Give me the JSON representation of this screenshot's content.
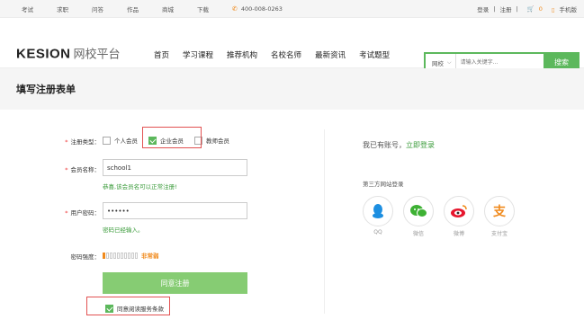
{
  "topbar": {
    "nav": [
      "考试",
      "求职",
      "问答",
      "作品",
      "商城",
      "下载"
    ],
    "phone": "400-008-0263",
    "login": "登录",
    "register": "注册",
    "cart_count": "0",
    "mobile": "手机版"
  },
  "header": {
    "logo_main": "KESION",
    "logo_sub": "网校平台",
    "nav": [
      "首页",
      "学习课程",
      "推荐机构",
      "名校名师",
      "最新资讯",
      "考试题型"
    ],
    "search": {
      "scope": "网校",
      "placeholder": "请输入关键字...",
      "button": "搜索"
    }
  },
  "page_title": "填写注册表单",
  "form": {
    "type_label": "注册类型：",
    "types": [
      {
        "label": "个人会员",
        "checked": false
      },
      {
        "label": "企业会员",
        "checked": true
      },
      {
        "label": "教师会员",
        "checked": false
      }
    ],
    "name_label": "会员名称：",
    "name_value": "school1",
    "name_hint": "恭喜,该会员名可以正常注册!",
    "password_label": "用户密码：",
    "password_value": "••••••",
    "password_hint": "密码已经输入。",
    "strength_label": "密码强度：",
    "strength_text": "非常弱",
    "submit": "同意注册",
    "agree": "同意阅读服务条款"
  },
  "side": {
    "have_account": "我已有账号，",
    "login_now": "立即登录",
    "third_party_title": "第三方网站登录",
    "providers": [
      {
        "name": "QQ",
        "icon": "qq-icon",
        "glyph": "♟",
        "color": "#1d8fe1"
      },
      {
        "name": "微信",
        "icon": "wechat-icon",
        "glyph": "●●",
        "color": "#3eb134"
      },
      {
        "name": "微博",
        "icon": "weibo-icon",
        "glyph": "◉",
        "color": "#e6162d"
      },
      {
        "name": "支付宝",
        "icon": "alipay-icon",
        "glyph": "支",
        "color": "#f08a1c"
      }
    ]
  },
  "colors": {
    "accent": "#5cb85c",
    "button": "#86cc73",
    "highlight_box": "#e25252",
    "warning": "#f08a1c"
  }
}
